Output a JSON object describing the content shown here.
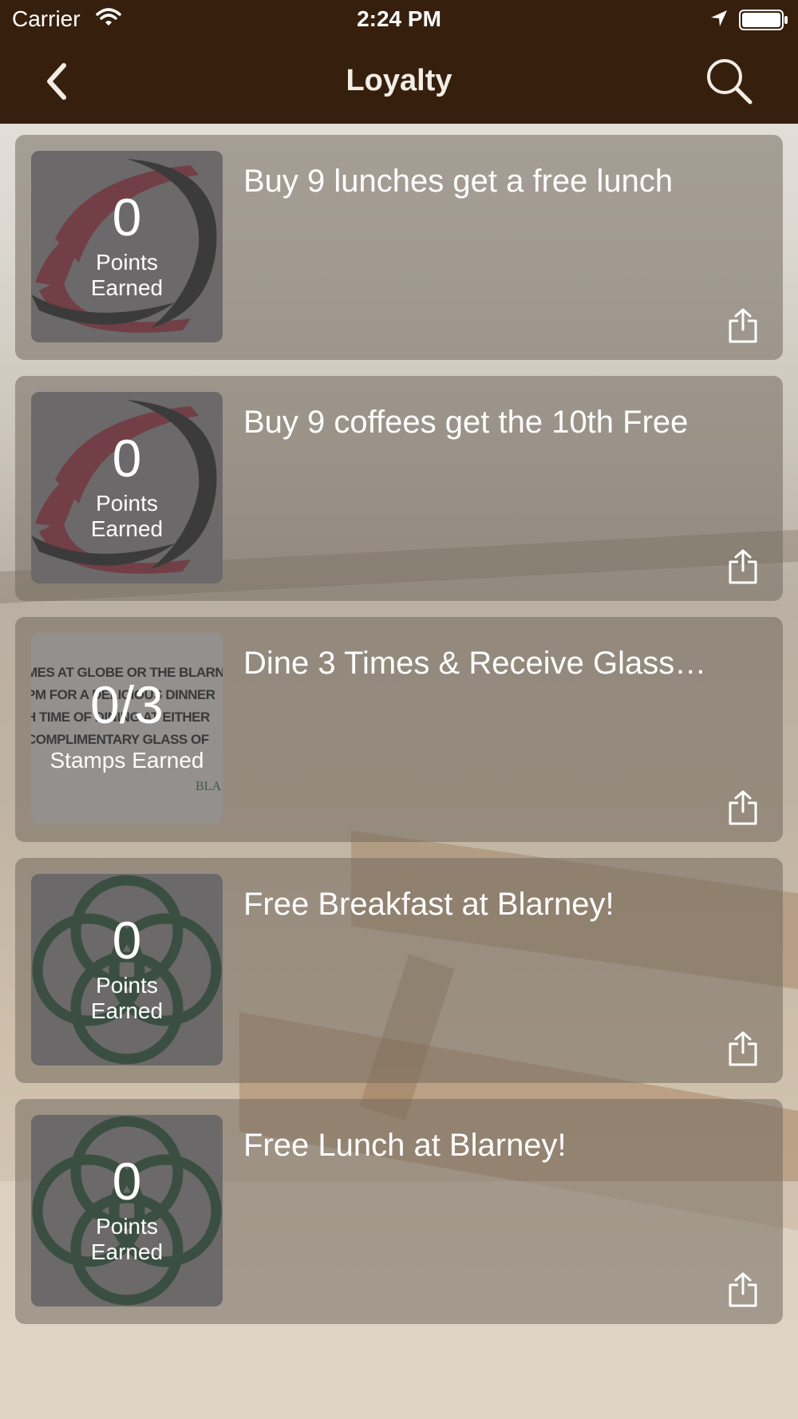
{
  "status_bar": {
    "carrier": "Carrier",
    "time": "2:24 PM"
  },
  "nav": {
    "title": "Loyalty",
    "back_icon": "chevron-left-icon",
    "search_icon": "search-icon"
  },
  "colors": {
    "nav_background": "#36200d",
    "card_background": "rgba(115,105,95,0.55)",
    "logo_red": "#8b1a2b",
    "logo_green": "#0f3d1f"
  },
  "cards": [
    {
      "title": "Buy 9 lunches get a free lunch",
      "count": "0",
      "label_line1": "Points",
      "label_line2": "Earned",
      "logo": "swoosh"
    },
    {
      "title": "Buy 9 coffees get the 10th Free",
      "count": "0",
      "label_line1": "Points",
      "label_line2": "Earned",
      "logo": "swoosh"
    },
    {
      "title": "Dine 3 Times & Receive Glass…",
      "count": "0/3",
      "label": "Stamps Earned",
      "logo": "poster",
      "poster_lines": [
        "MES AT GLOBE OR THE BLARN",
        "PM FOR A DELICIOUS DINNER",
        "H TIME OF DINING AT EITHER",
        "COMPLIMENTARY GLASS OF"
      ],
      "poster_brand": "BLA"
    },
    {
      "title": "Free Breakfast at Blarney!",
      "count": "0",
      "label_line1": "Points",
      "label_line2": "Earned",
      "logo": "knot"
    },
    {
      "title": "Free Lunch at Blarney!",
      "count": "0",
      "label_line1": "Points",
      "label_line2": "Earned",
      "logo": "knot"
    }
  ]
}
